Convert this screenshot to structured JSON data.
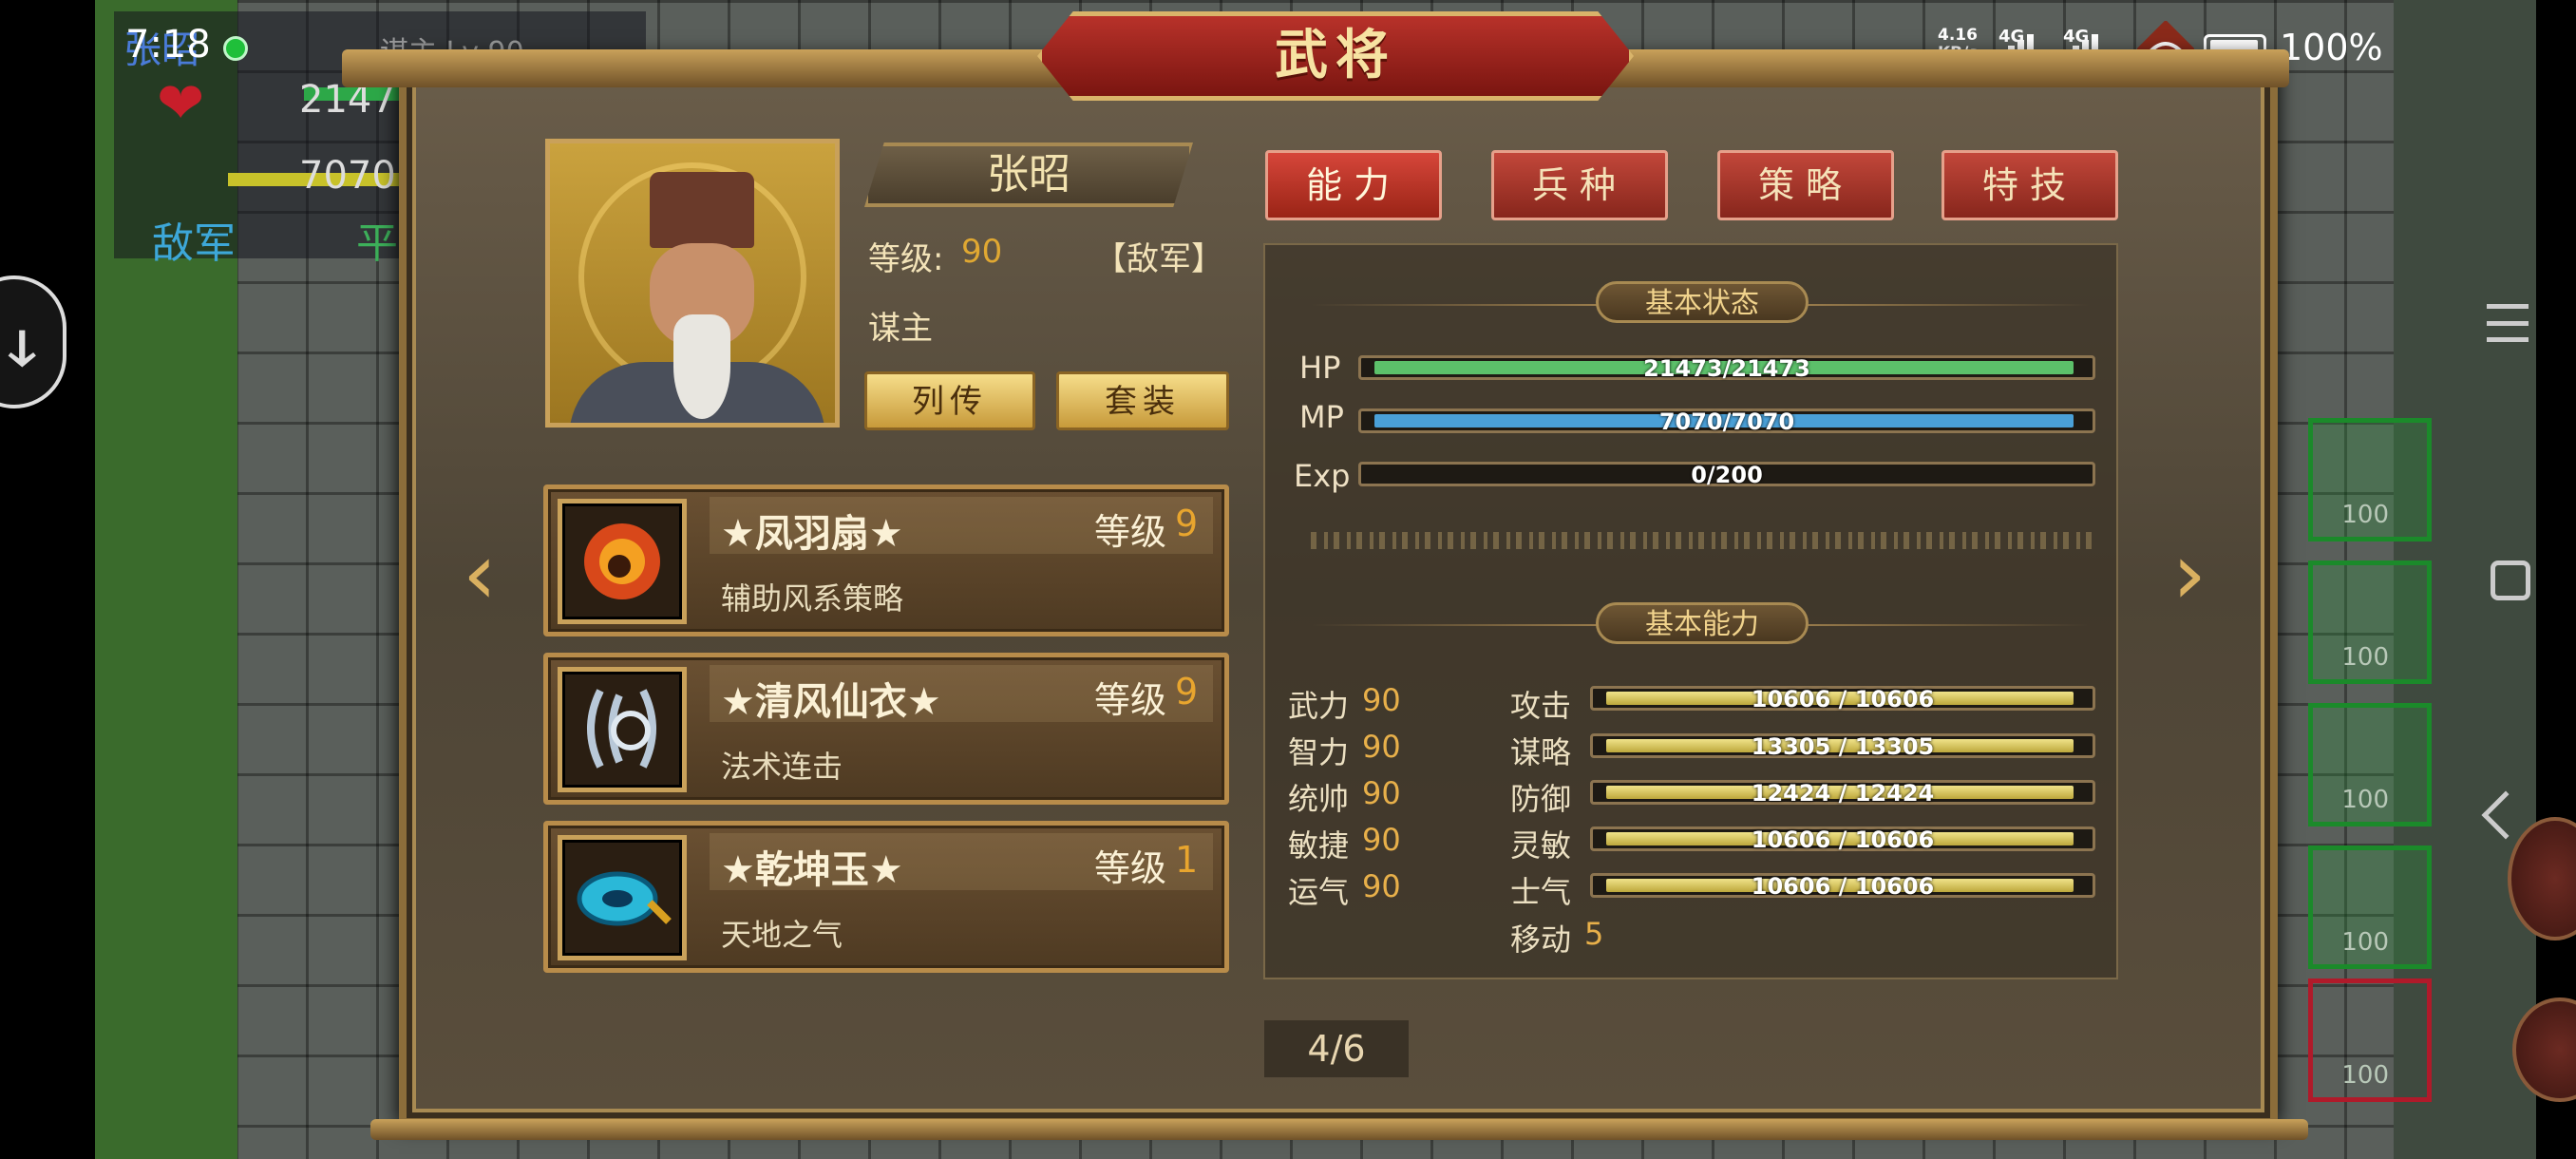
{
  "status_bar": {
    "time": "7:18",
    "speed_value": "4.16",
    "speed_unit": "KB/s",
    "net1": "4G",
    "net2": "4G",
    "battery": "100%"
  },
  "background_hud": {
    "enemy_name": "张昭",
    "enemy_role_level": "谋主 Lv 90",
    "hp_value": "2147",
    "mp_value": "7070",
    "tag_enemy": "敌军",
    "tag_2": "平",
    "cell_value": "100"
  },
  "dialog": {
    "title": "武将",
    "general": {
      "name": "张昭",
      "level_label": "等级:",
      "level": "90",
      "faction": "【敌军】",
      "role": "谋主"
    },
    "buttons": {
      "biography": "列传",
      "set": "套装"
    },
    "equipment": [
      {
        "name": "★凤羽扇★",
        "level_label": "等级",
        "level": "9",
        "desc": "辅助风系策略",
        "icon": "fire-fan-icon"
      },
      {
        "name": "★清风仙衣★",
        "level_label": "等级",
        "level": "9",
        "desc": "法术连击",
        "icon": "wind-robe-icon"
      },
      {
        "name": "★乾坤玉★",
        "level_label": "等级",
        "level": "1",
        "desc": "天地之气",
        "icon": "jade-icon"
      }
    ],
    "tabs": [
      "能力",
      "兵种",
      "策略",
      "特技"
    ],
    "basic_status": {
      "title": "基本状态",
      "hp": {
        "label": "HP",
        "text": "21473/21473",
        "fraction": 1.0,
        "color": "#5cc06a"
      },
      "mp": {
        "label": "MP",
        "text": "7070/7070",
        "fraction": 1.0,
        "color": "#4aa0d8"
      },
      "exp": {
        "label": "Exp",
        "text": "0/200",
        "fraction": 0.0,
        "color": "#d8c050"
      }
    },
    "basic_ability": {
      "title": "基本能力",
      "attributes": [
        {
          "label": "武力",
          "value": "90"
        },
        {
          "label": "智力",
          "value": "90"
        },
        {
          "label": "统帅",
          "value": "90"
        },
        {
          "label": "敏捷",
          "value": "90"
        },
        {
          "label": "运气",
          "value": "90"
        }
      ],
      "combat": [
        {
          "label": "攻击",
          "text": "10606 / 10606",
          "fraction": 1.0
        },
        {
          "label": "谋略",
          "text": "13305 / 13305",
          "fraction": 1.0
        },
        {
          "label": "防御",
          "text": "12424 / 12424",
          "fraction": 1.0
        },
        {
          "label": "灵敏",
          "text": "10606 / 10606",
          "fraction": 1.0
        },
        {
          "label": "士气",
          "text": "10606 / 10606",
          "fraction": 1.0
        }
      ],
      "move_label": "移动",
      "move_value": "5"
    },
    "page_indicator": "4/6"
  }
}
